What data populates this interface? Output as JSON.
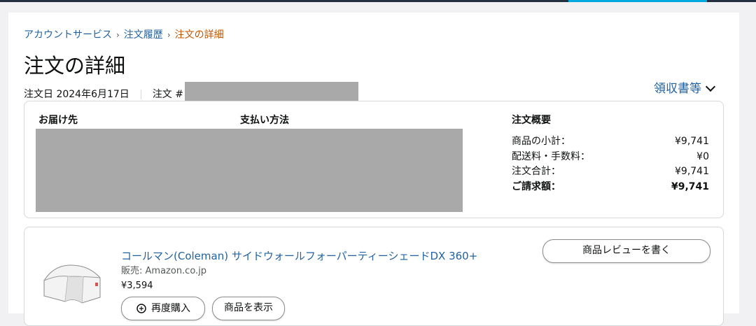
{
  "breadcrumb": {
    "items": [
      "アカウントサービス",
      "注文履歴"
    ],
    "current": "注文の詳細",
    "separator": "›"
  },
  "page": {
    "title": "注文の詳細"
  },
  "order_meta": {
    "date_label": "注文日 2024年6月17日",
    "order_label": "注文 #"
  },
  "receipts_link": "領収書等",
  "summary": {
    "shipping_header": "お届け先",
    "payment_header": "支払い方法",
    "summary_header": "注文概要",
    "rows": [
      {
        "label": "商品の小計：",
        "value": "¥9,741"
      },
      {
        "label": "配送料・手数料：",
        "value": "¥0"
      },
      {
        "label": "注文合計：",
        "value": "¥9,741"
      },
      {
        "label": "ご請求額：",
        "value": "¥9,741"
      }
    ]
  },
  "item": {
    "title": "コールマン(Coleman) サイドウォールフォーパーティーシェードDX 360+",
    "seller": "販売: Amazon.co.jp",
    "price": "¥3,594",
    "review_button": "商品レビューを書く",
    "rebuy_button": "再度購入",
    "view_button": "商品を表示"
  },
  "colors": {
    "link": "#2162a1",
    "breadcrumb_current": "#c45500",
    "background": "#f1f1f3",
    "redaction": "#a9a9a9"
  },
  "icons": [
    "chevron-down-icon",
    "rebuy-icon",
    "product-thumbnail"
  ]
}
